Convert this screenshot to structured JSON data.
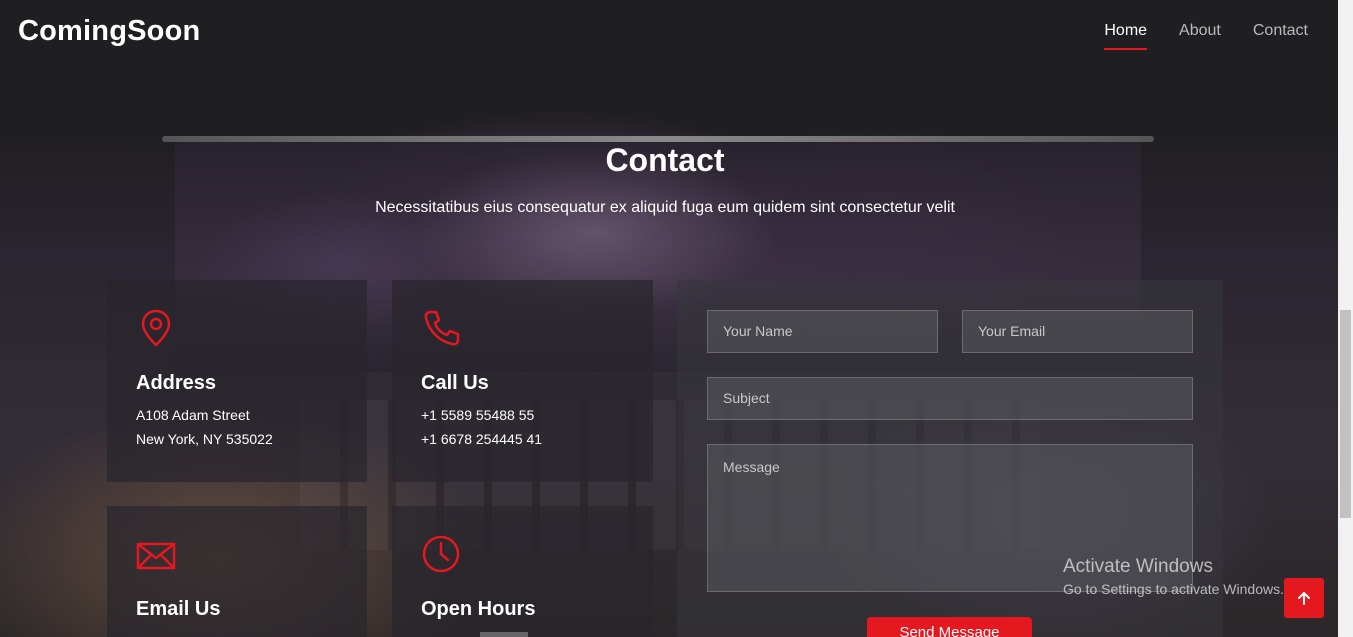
{
  "header": {
    "logo": "ComingSoon",
    "nav": [
      {
        "label": "Home",
        "active": true
      },
      {
        "label": "About",
        "active": false
      },
      {
        "label": "Contact",
        "active": false
      }
    ]
  },
  "section": {
    "title": "Contact",
    "subtitle": "Necessitatibus eius consequatur ex aliquid fuga eum quidem sint consectetur velit"
  },
  "info": {
    "address": {
      "icon": "map-pin-icon",
      "title": "Address",
      "lines": [
        "A108 Adam Street",
        "New York, NY 535022"
      ]
    },
    "call": {
      "icon": "phone-icon",
      "title": "Call Us",
      "lines": [
        "+1 5589 55488 55",
        "+1 6678 254445 41"
      ]
    },
    "email": {
      "icon": "envelope-icon",
      "title": "Email Us"
    },
    "hours": {
      "icon": "clock-icon",
      "title": "Open Hours"
    }
  },
  "form": {
    "name_placeholder": "Your Name",
    "email_placeholder": "Your Email",
    "subject_placeholder": "Subject",
    "message_placeholder": "Message",
    "send_label": "Send Message"
  },
  "watermark": {
    "line1": "Activate Windows",
    "line2": "Go to Settings to activate Windows."
  },
  "colors": {
    "accent": "#e5171f",
    "background": "#1c1b1d"
  }
}
